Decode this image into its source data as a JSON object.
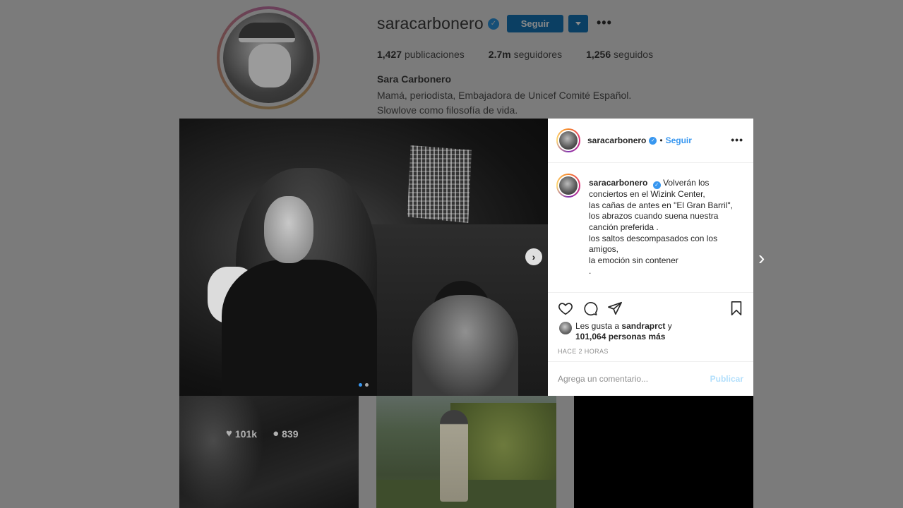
{
  "profile": {
    "username": "saracarbonero",
    "follow_label": "Seguir",
    "more_label": "•••",
    "stats": {
      "posts_value": "1,427",
      "posts_label": "publicaciones",
      "followers_value": "2.7m",
      "followers_label": "seguidores",
      "following_value": "1,256",
      "following_label": "seguidos"
    },
    "full_name": "Sara Carbonero",
    "bio_lines": [
      "Mamá, periodista, Embajadora de Unicef Comité Español.",
      "Slowlove como filosofía de vida."
    ]
  },
  "grid": {
    "thumb1": {
      "likes": "101k",
      "comments": "839"
    }
  },
  "post": {
    "header": {
      "username": "saracarbonero",
      "separator": "•",
      "follow_label": "Seguir",
      "more_label": "•••"
    },
    "caption": {
      "username": "saracarbonero",
      "lines": [
        "Volverán los",
        "conciertos en el Wizink Center,",
        "las cañas de antes en \"El Gran Barril\",",
        "los abrazos cuando suena nuestra",
        "canción preferida .",
        "los saltos descompasados con los",
        "amigos,",
        "la emoción sin contener",
        "."
      ]
    },
    "likes": {
      "prefix": "Les gusta a",
      "liker": "sandraprct",
      "joiner": "y",
      "count": "101,064 personas más"
    },
    "time": "HACE 2 HORAS",
    "comment_placeholder": "Agrega un comentario...",
    "publish_label": "Publicar",
    "carousel": {
      "total": 2,
      "current": 1
    }
  },
  "colors": {
    "accent_blue": "#3897f0",
    "publish_disabled": "#b2dffc",
    "overlay_bg": "#7b7b7b"
  },
  "icons": [
    "verified-icon",
    "chevron-down-icon",
    "heart-icon",
    "comment-icon",
    "share-icon",
    "bookmark-icon",
    "chevron-right-icon"
  ]
}
